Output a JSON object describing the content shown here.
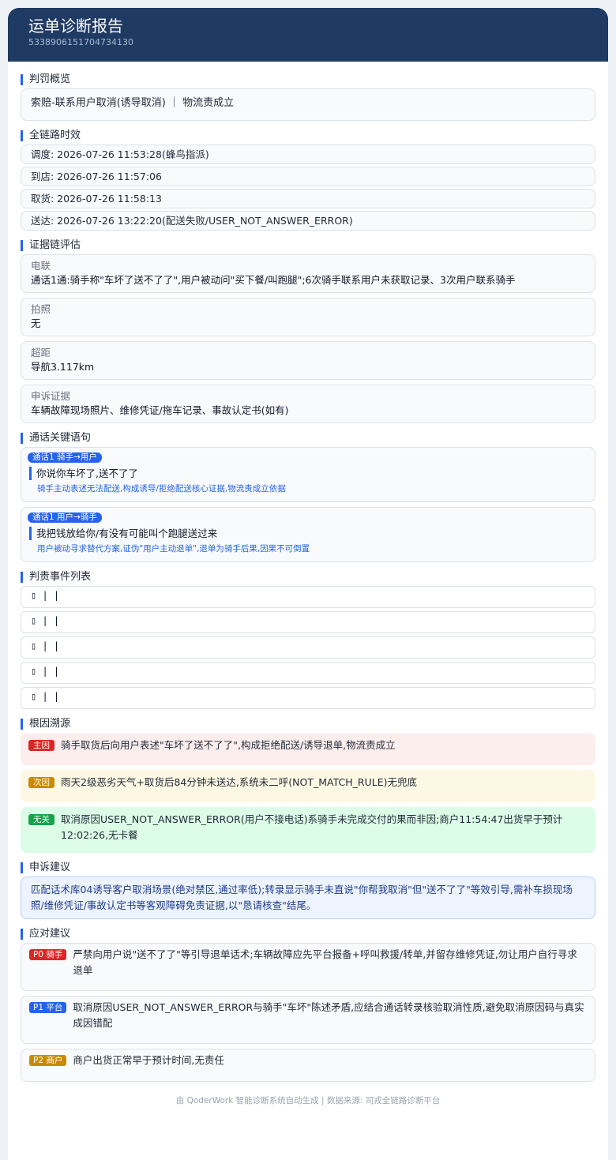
{
  "header": {
    "title": "运单诊断报告",
    "order_id": "5338906151704734130"
  },
  "penalty": {
    "section_title": "判罚概览",
    "summary": "索赔-联系用户取消(诱导取消) ｜ 物流责成立"
  },
  "timeline": {
    "section_title": "全链路时效",
    "rows": [
      "调度: 2026-07-26 11:53:28(蜂鸟指派)",
      "到店: 2026-07-26 11:57:06",
      "取货: 2026-07-26 11:58:13",
      "送达: 2026-07-26 13:22:20(配送失败/USER_NOT_ANSWER_ERROR)"
    ]
  },
  "evidence": {
    "section_title": "证据链评估",
    "items": [
      {
        "label": "电联",
        "value": "通话1通:骑手称\"车坏了送不了了\",用户被动问\"买下餐/叫跑腿\";6次骑手联系用户未获取记录、3次用户联系骑手"
      },
      {
        "label": "拍照",
        "value": "无"
      },
      {
        "label": "超距",
        "value": "导航3.117km"
      },
      {
        "label": "申诉证据",
        "value": "车辆故障现场照片、维修凭证/拖车记录、事故认定书(如有)"
      }
    ]
  },
  "calls": {
    "section_title": "通话关键语句",
    "items": [
      {
        "badge": "通话1  骑手→用户",
        "quote": "你说你车坏了,送不了了",
        "note": "骑手主动表述无法配送,构成诱导/拒绝配送核心证据,物流责成立依据"
      },
      {
        "badge": "通话1  用户→骑手",
        "quote": "我把钱放给你/有没有可能叫个跑腿送过来",
        "note": "用户被动寻求替代方案,证伪\"用户主动退单\",退单为骑手后果,因果不可倒置"
      }
    ]
  },
  "events": {
    "section_title": "判责事件列表",
    "rows": [
      "▯ | |",
      "▯ | |",
      "▯ | |",
      "▯ | |",
      "▯ | |"
    ]
  },
  "root_cause": {
    "section_title": "根因溯源",
    "main": {
      "tag": "主因",
      "text": "骑手取货后向用户表述\"车坏了送不了了\",构成拒绝配送/诱导退单,物流责成立"
    },
    "secondary": {
      "tag": "次因",
      "text": "雨天2级恶劣天气+取货后84分钟未送达,系统未二呼(NOT_MATCH_RULE)无兜底"
    },
    "unrelated": {
      "tag": "无关",
      "text": "取消原因USER_NOT_ANSWER_ERROR(用户不接电话)系骑手未完成交付的果而非因;商户11:54:47出货早于预计12:02:26,无卡餐"
    }
  },
  "appeal": {
    "section_title": "申诉建议",
    "text": "匹配话术库04诱导客户取消场景(绝对禁区,通过率低);转录显示骑手未直说\"你帮我取消\"但\"送不了了\"等效引导,需补车损现场照/维修凭证/事故认定书等客观障碍免责证据,以\"恳请核查\"结尾。"
  },
  "response": {
    "section_title": "应对建议",
    "items": [
      {
        "tag": "P0 骑手",
        "text": "严禁向用户说\"送不了了\"等引导退单话术;车辆故障应先平台报备+呼叫救援/转单,并留存维修凭证,勿让用户自行寻求退单"
      },
      {
        "tag": "P1 平台",
        "text": "取消原因USER_NOT_ANSWER_ERROR与骑手\"车坏\"陈述矛盾,应结合通话转录核验取消性质,避免取消原因码与真实成因错配"
      },
      {
        "tag": "P2 商户",
        "text": "商户出货正常早于预计时间,无责任"
      }
    ]
  },
  "footer": {
    "text": "由 QoderWork 智能诊断系统自动生成 | 数据来源: 司戎全链路诊断平台"
  }
}
